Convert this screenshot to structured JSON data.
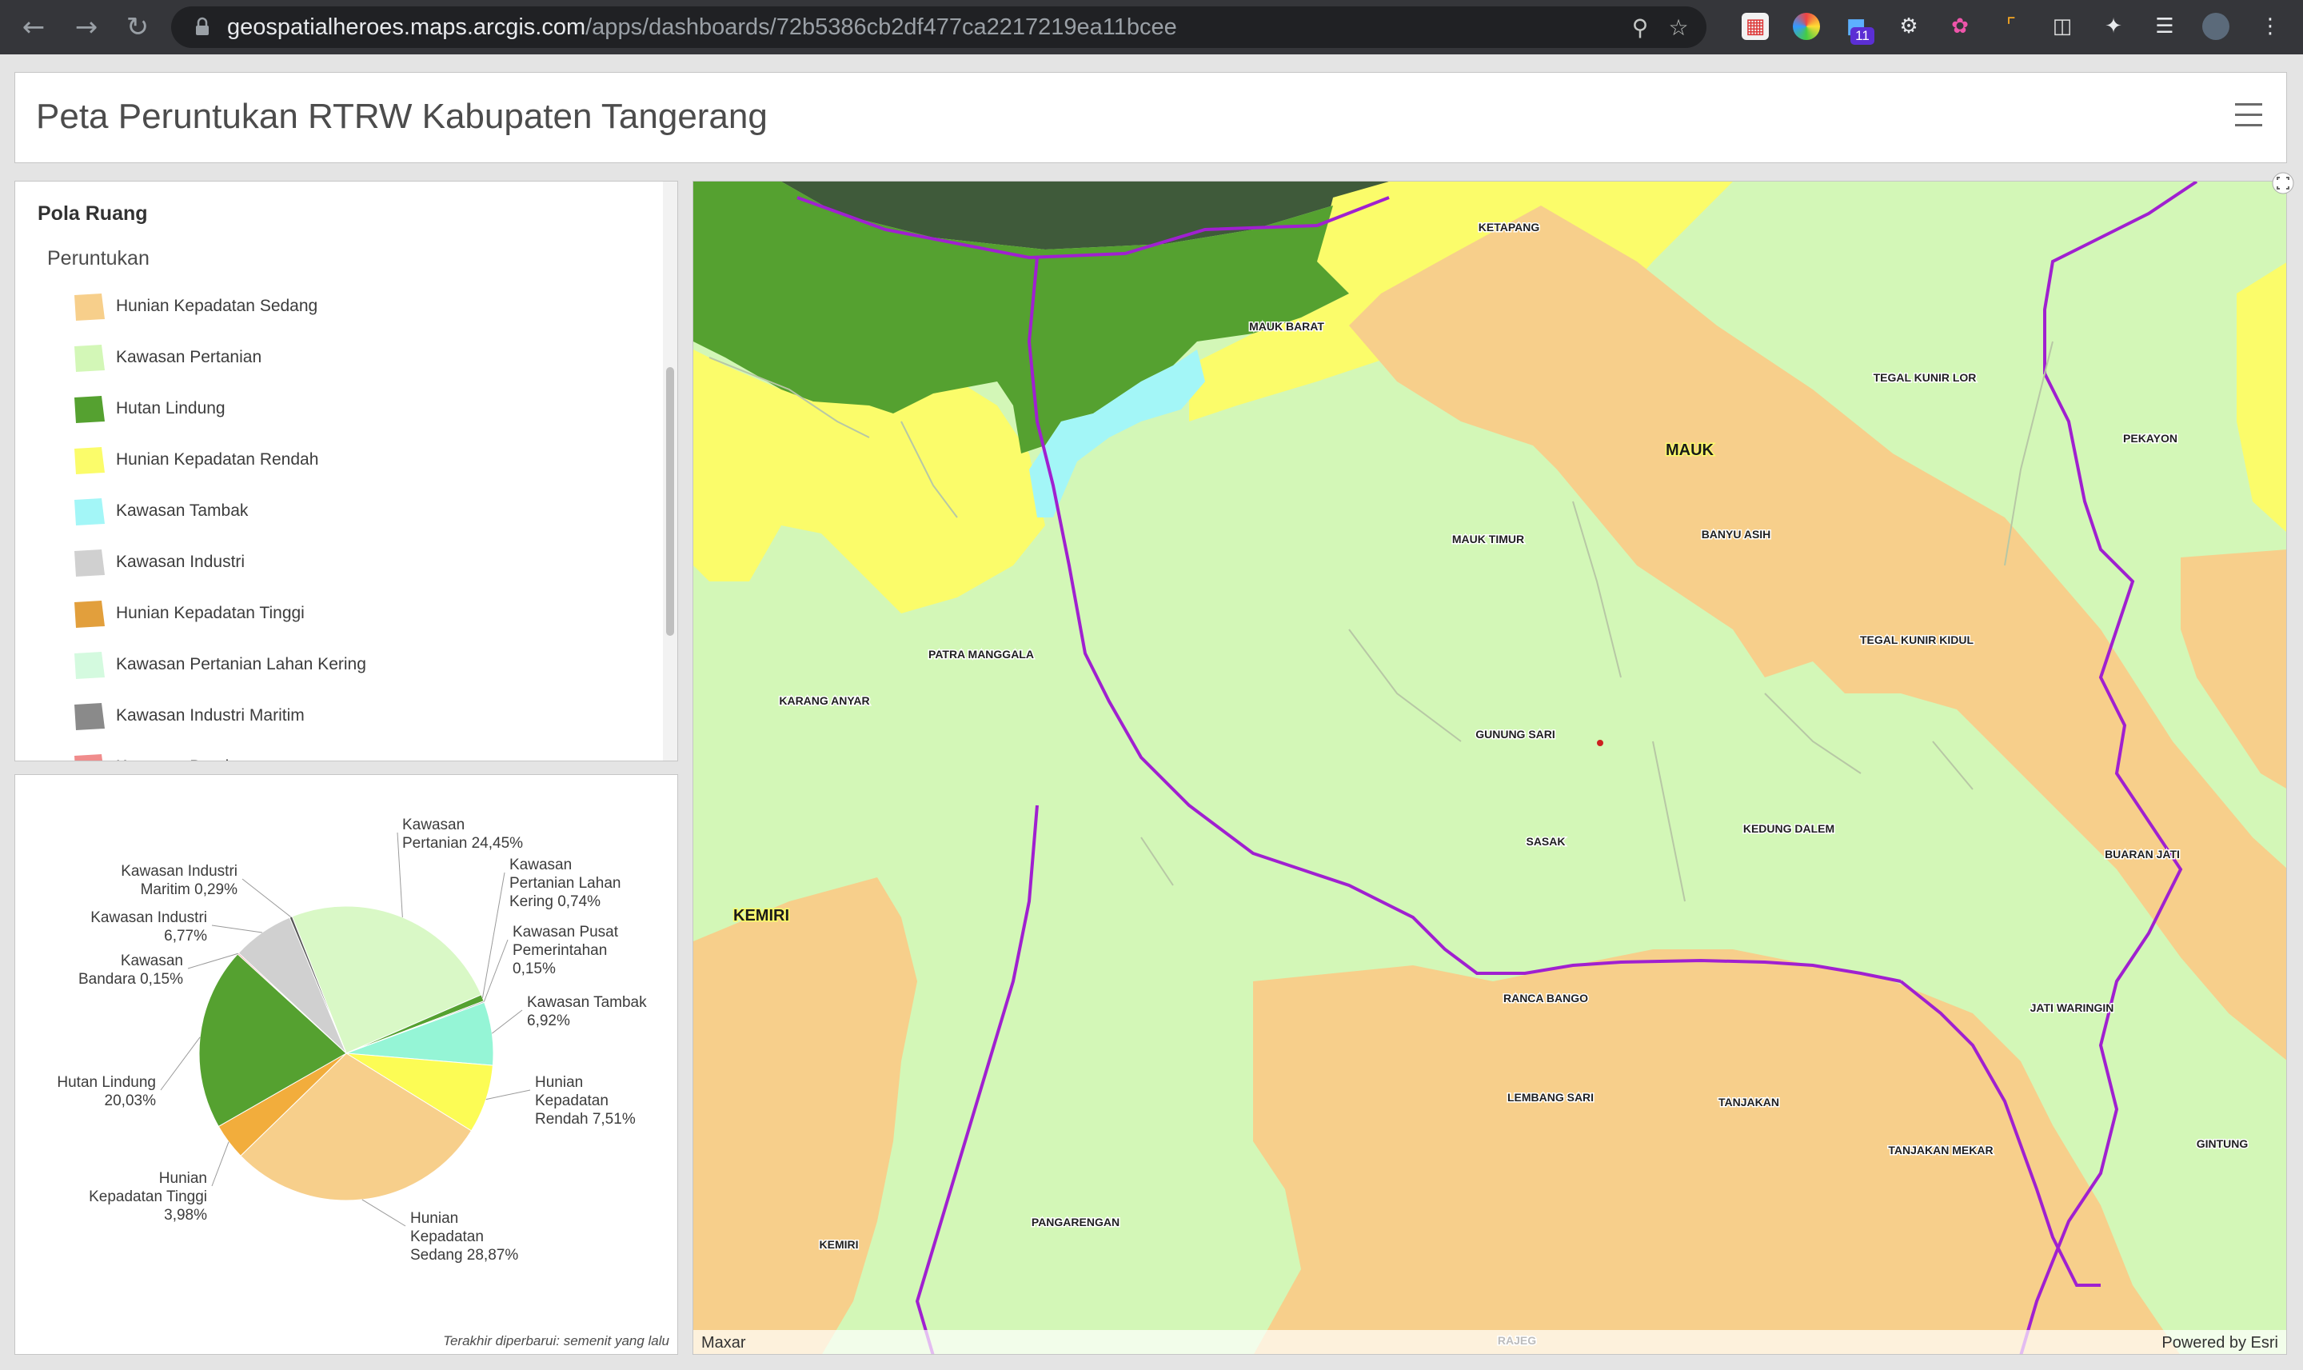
{
  "browser": {
    "url_host": "geospatialheroes.maps.arcgis.com",
    "url_path": "/apps/dashboards/72b5386cb2df477ca2217219ea11bcee",
    "extension_badge": "11"
  },
  "header": {
    "title": "Peta Peruntukan RTRW Kabupaten Tangerang"
  },
  "legend": {
    "title": "Pola Ruang",
    "subtitle": "Peruntukan",
    "items": [
      {
        "label": "Hunian Kepadatan Sedang",
        "color": "#f7cf8b"
      },
      {
        "label": "Kawasan Pertanian",
        "color": "#d3f7b7"
      },
      {
        "label": "Hutan Lindung",
        "color": "#55a130"
      },
      {
        "label": "Hunian Kepadatan Rendah",
        "color": "#fbfc6a"
      },
      {
        "label": "Kawasan Tambak",
        "color": "#a3f6f7"
      },
      {
        "label": "Kawasan Industri",
        "color": "#d0d0d0"
      },
      {
        "label": "Hunian Kepadatan Tinggi",
        "color": "#e29f3c"
      },
      {
        "label": "Kawasan Pertanian Lahan Kering",
        "color": "#d4fadf"
      },
      {
        "label": "Kawasan Industri Maritim",
        "color": "#8a8a8a"
      },
      {
        "label": "Kawasan Bandara",
        "color": "#f08c8c"
      }
    ]
  },
  "chart_data": {
    "type": "pie",
    "series": [
      {
        "name": "Kawasan Pertanian",
        "value": 24.45,
        "label_text": "Kawasan Pertanian 24,45%",
        "color": "#d9f8c6"
      },
      {
        "name": "Kawasan Pertanian Lahan Kering",
        "value": 0.74,
        "label_text": "Kawasan Pertanian Lahan Kering 0,74%",
        "color": "#55a130"
      },
      {
        "name": "Kawasan Pusat Pemerintahan",
        "value": 0.15,
        "label_text": "Kawasan Pusat Pemerintahan 0,15%",
        "color": "#a0a0a0"
      },
      {
        "name": "Kawasan Tambak",
        "value": 6.92,
        "label_text": "Kawasan Tambak 6,92%",
        "color": "#95f5d6"
      },
      {
        "name": "Hunian Kepadatan Rendah",
        "value": 7.51,
        "label_text": "Hunian Kepadatan Rendah 7,51%",
        "color": "#fcfc55"
      },
      {
        "name": "Hunian Kepadatan Sedang",
        "value": 28.87,
        "label_text": "Hunian Kepadatan Sedang 28,87%",
        "color": "#f7cf8b"
      },
      {
        "name": "Hunian Kepadatan Tinggi",
        "value": 3.98,
        "label_text": "Hunian Kepadatan Tinggi 3,98%",
        "color": "#f2ad3c"
      },
      {
        "name": "Hutan Lindung",
        "value": 20.03,
        "label_text": "Hutan Lindung 20,03%",
        "color": "#55a130"
      },
      {
        "name": "Kawasan Bandara",
        "value": 0.15,
        "label_text": "Kawasan Bandara 0,15%",
        "color": "#f08c8c"
      },
      {
        "name": "Kawasan Industri",
        "value": 6.77,
        "label_text": "Kawasan Industri 6,77%",
        "color": "#d0d0d0"
      },
      {
        "name": "Kawasan Industri Maritim",
        "value": 0.29,
        "label_text": "Kawasan Industri Maritim 0,29%",
        "color": "#555555"
      }
    ],
    "labels": [
      {
        "lines": [
          "Kawasan",
          "Pertanian 24,45%"
        ]
      },
      {
        "lines": [
          "Kawasan",
          "Pertanian Lahan",
          "Kering 0,74%"
        ]
      },
      {
        "lines": [
          "Kawasan Pusat",
          "Pemerintahan",
          "0,15%"
        ]
      },
      {
        "lines": [
          "Kawasan Tambak",
          "6,92%"
        ]
      },
      {
        "lines": [
          "Hunian",
          "Kepadatan",
          "Rendah 7,51%"
        ]
      },
      {
        "lines": [
          "Hunian",
          "Kepadatan",
          "Sedang 28,87%"
        ]
      },
      {
        "lines": [
          "Hunian",
          "Kepadatan Tinggi",
          "3,98%"
        ]
      },
      {
        "lines": [
          "Hutan Lindung",
          "20,03%"
        ]
      },
      {
        "lines": [
          "Kawasan",
          "Bandara 0,15%"
        ]
      },
      {
        "lines": [
          "Kawasan Industri",
          "6,77%"
        ]
      },
      {
        "lines": [
          "Kawasan Industri",
          "Maritim 0,29%"
        ]
      }
    ]
  },
  "chart_footer": "Terakhir diperbarui: semenit yang lalu",
  "map": {
    "places": [
      {
        "name": "KETAPANG"
      },
      {
        "name": "MAUK BARAT"
      },
      {
        "name": "MAUK"
      },
      {
        "name": "TEGAL KUNIR LOR"
      },
      {
        "name": "PEKAYON"
      },
      {
        "name": "MAUK TIMUR"
      },
      {
        "name": "BANYU ASIH"
      },
      {
        "name": "TEGAL KUNIR KIDUL"
      },
      {
        "name": "PATRA MANGGALA"
      },
      {
        "name": "KARANG ANYAR"
      },
      {
        "name": "GUNUNG SARI"
      },
      {
        "name": "KEDUNG DALEM"
      },
      {
        "name": "SASAK"
      },
      {
        "name": "BUARAN JATI"
      },
      {
        "name": "KEMIRI"
      },
      {
        "name": "RANCA BANGO"
      },
      {
        "name": "JATI WARINGIN"
      },
      {
        "name": "LEMBANG SARI"
      },
      {
        "name": "TANJAKAN"
      },
      {
        "name": "TANJAKAN MEKAR"
      },
      {
        "name": "GINTUNG"
      },
      {
        "name": "KEMIRI"
      },
      {
        "name": "PANGARENGAN"
      },
      {
        "name": "RAJEG"
      }
    ],
    "attribution_left": "Maxar",
    "attribution_right": "Powered by Esri"
  }
}
